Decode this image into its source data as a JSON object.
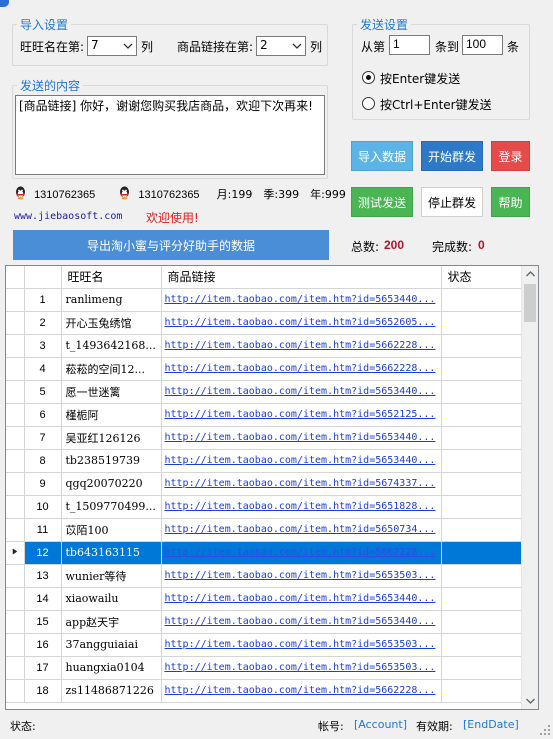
{
  "import_settings": {
    "legend": "导入设置",
    "wangwang_col_label": "旺旺名在第:",
    "wangwang_col_value": "7",
    "col_suffix": "列",
    "link_col_label": "商品链接在第:",
    "link_col_value": "2",
    "col_suffix2": "列"
  },
  "send_settings": {
    "legend": "发送设置",
    "from_label": "从第",
    "from_value": "1",
    "to_label": "条到",
    "to_value": "100",
    "unit": "条",
    "radio_enter": "按Enter键发送",
    "radio_ctrl_enter": "按Ctrl+Enter键发送",
    "radio_enter_checked": true
  },
  "content": {
    "legend": "发送的内容",
    "text": "[商品链接] 你好，谢谢您购买我店商品，欢迎下次再来!"
  },
  "buttons": {
    "import": "导入数据",
    "start": "开始群发",
    "login": "登录",
    "test_send": "测试发送",
    "stop": "停止群发",
    "help": "帮助",
    "export": "导出淘小蜜与评分好助手的数据"
  },
  "contact": {
    "qq1": "1310762365",
    "qq2": "1310762365",
    "month": "月:199",
    "quarter": "季:399",
    "year": "年:999",
    "website": "www.jiebaosoft.com",
    "welcome": "欢迎使用!"
  },
  "totals": {
    "total_label": "总数:",
    "total_value": "200",
    "done_label": "完成数:",
    "done_value": "0"
  },
  "table": {
    "headers": [
      "旺旺名",
      "商品链接",
      "状态"
    ],
    "selected_row": 12,
    "rows": [
      {
        "idx": "1",
        "name": "ranlimeng",
        "link": "http://item.taobao.com/item.htm?id=5653440..."
      },
      {
        "idx": "2",
        "name": "开心玉兔绣馆",
        "link": "http://item.taobao.com/item.htm?id=5652605..."
      },
      {
        "idx": "3",
        "name": "t_1493642168...",
        "link": "http://item.taobao.com/item.htm?id=5662228..."
      },
      {
        "idx": "4",
        "name": "菘菘的空间12...",
        "link": "http://item.taobao.com/item.htm?id=5662228..."
      },
      {
        "idx": "5",
        "name": "愿一世迷篱",
        "link": "http://item.taobao.com/item.htm?id=5653440..."
      },
      {
        "idx": "6",
        "name": "槿栀阿",
        "link": "http://item.taobao.com/item.htm?id=5652125..."
      },
      {
        "idx": "7",
        "name": "吴亚红126126",
        "link": "http://item.taobao.com/item.htm?id=5653440..."
      },
      {
        "idx": "8",
        "name": "tb238519739",
        "link": "http://item.taobao.com/item.htm?id=5653440..."
      },
      {
        "idx": "9",
        "name": "qgq20070220",
        "link": "http://item.taobao.com/item.htm?id=5674337..."
      },
      {
        "idx": "10",
        "name": "t_1509770499...",
        "link": "http://item.taobao.com/item.htm?id=5651828..."
      },
      {
        "idx": "11",
        "name": "苡陌100",
        "link": "http://item.taobao.com/item.htm?id=5650734..."
      },
      {
        "idx": "12",
        "name": "tb643163115",
        "link": "http://item.taobao.com/item.htm?id=5662228..."
      },
      {
        "idx": "13",
        "name": "wunier等待",
        "link": "http://item.taobao.com/item.htm?id=5653503..."
      },
      {
        "idx": "14",
        "name": "xiaowailu",
        "link": "http://item.taobao.com/item.htm?id=5653440..."
      },
      {
        "idx": "15",
        "name": "app赵天宇",
        "link": "http://item.taobao.com/item.htm?id=5653440..."
      },
      {
        "idx": "16",
        "name": "37angguiaiai",
        "link": "http://item.taobao.com/item.htm?id=5653503..."
      },
      {
        "idx": "17",
        "name": "huangxia0104",
        "link": "http://item.taobao.com/item.htm?id=5653503..."
      },
      {
        "idx": "18",
        "name": "zs11486871226",
        "link": "http://item.taobao.com/item.htm?id=5662228..."
      }
    ]
  },
  "status": {
    "label": "状态:",
    "account_label": "帐号:",
    "account_value": "[Account]",
    "expiry_label": "有效期:",
    "expiry_value": "[EndDate]"
  },
  "colors": {
    "legend": "#1e78d2",
    "import_btn": "#5bb4e5",
    "start_btn": "#2d79c7",
    "login_btn": "#e54b4b",
    "test_btn": "#49b653",
    "help_btn": "#49b653",
    "export_btn": "#4a8ed8",
    "selection": "#0078d7",
    "total_value": "#b0152a"
  }
}
